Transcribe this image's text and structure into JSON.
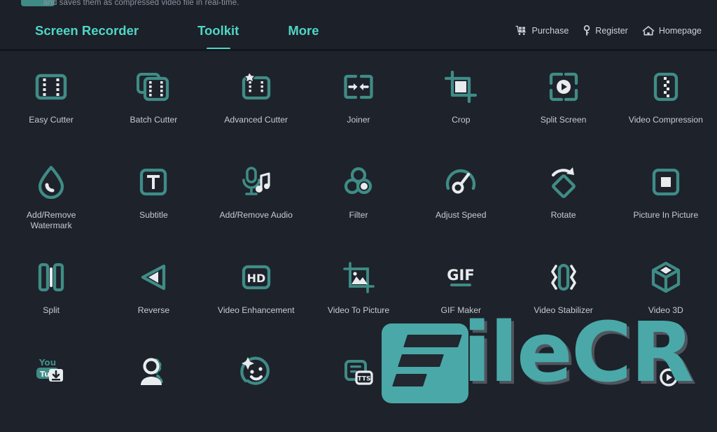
{
  "colors": {
    "background": "#1e222b",
    "header_bg": "#1c2029",
    "accent_teal": "#4fd6c4",
    "icon_teal": "#3f8c86",
    "icon_white": "#e8ecef",
    "label": "#c6cbd3",
    "watermark_teal": "#4aa8a8"
  },
  "header": {
    "description": "and saves them as compressed video file in real-time.",
    "tabs": [
      {
        "label": "Screen Recorder",
        "active": false
      },
      {
        "label": "Toolkit",
        "active": true
      },
      {
        "label": "More",
        "active": false
      }
    ],
    "nav": [
      {
        "label": "Purchase",
        "icon": "shopping-cart-icon"
      },
      {
        "label": "Register",
        "icon": "key-icon"
      },
      {
        "label": "Homepage",
        "icon": "home-icon"
      }
    ]
  },
  "toolkit": {
    "tools": [
      {
        "label": "Easy Cutter",
        "icon": "film-strip-icon"
      },
      {
        "label": "Batch Cutter",
        "icon": "film-strip-stack-icon"
      },
      {
        "label": "Advanced Cutter",
        "icon": "film-strip-star-icon"
      },
      {
        "label": "Joiner",
        "icon": "join-arrows-icon"
      },
      {
        "label": "Crop",
        "icon": "crop-icon"
      },
      {
        "label": "Split Screen",
        "icon": "split-screen-play-icon"
      },
      {
        "label": "Video Compression",
        "icon": "compress-zipper-icon"
      },
      {
        "label": "Add/Remove\nWatermark",
        "icon": "water-drop-icon"
      },
      {
        "label": "Subtitle",
        "icon": "text-box-t-icon"
      },
      {
        "label": "Add/Remove Audio",
        "icon": "microphone-note-icon"
      },
      {
        "label": "Filter",
        "icon": "three-circles-icon"
      },
      {
        "label": "Adjust Speed",
        "icon": "speedometer-icon"
      },
      {
        "label": "Rotate",
        "icon": "rotate-diamond-icon"
      },
      {
        "label": "Picture In Picture",
        "icon": "picture-in-picture-icon"
      },
      {
        "label": "Split",
        "icon": "split-bars-icon"
      },
      {
        "label": "Reverse",
        "icon": "reverse-triangle-icon"
      },
      {
        "label": "Video Enhancement",
        "icon": "hd-badge-icon"
      },
      {
        "label": "Video To Picture",
        "icon": "image-crop-icon"
      },
      {
        "label": "GIF Maker",
        "icon": "gif-text-icon"
      },
      {
        "label": "Video Stabilizer",
        "icon": "stabilizer-icon"
      },
      {
        "label": "Video 3D",
        "icon": "cube-3d-icon"
      },
      {
        "label": "",
        "icon": "youtube-download-icon"
      },
      {
        "label": "",
        "icon": "person-icon"
      },
      {
        "label": "",
        "icon": "face-sparkle-icon"
      },
      {
        "label": "",
        "icon": "tts-document-icon"
      },
      {
        "label": "",
        "icon": "hidden-icon"
      },
      {
        "label": "",
        "icon": "hidden-icon"
      },
      {
        "label": "",
        "icon": "video-play-icon"
      }
    ]
  },
  "watermark": {
    "text": "ileCR",
    "logo": "filecr-logo"
  }
}
